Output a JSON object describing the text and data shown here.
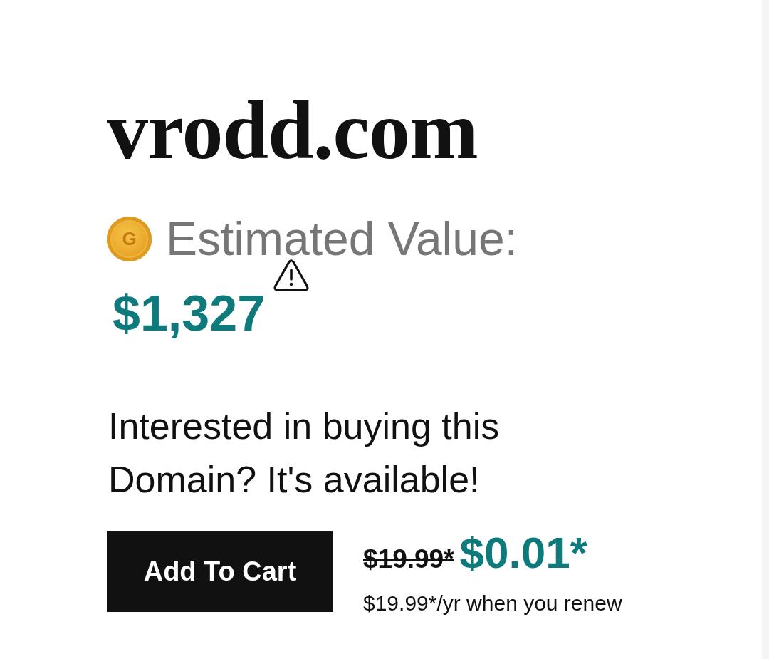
{
  "domain": {
    "name": "vrodd.com"
  },
  "valuation": {
    "badge_letter": "G",
    "label": "Estimated Value:",
    "amount": "$1,327"
  },
  "pitch": "Interested in buying this Domain? It's available!",
  "offer": {
    "button": "Add To Cart",
    "original_price": "$19.99*",
    "price": "$0.01*",
    "renewal": "$19.99*/yr when you renew"
  }
}
